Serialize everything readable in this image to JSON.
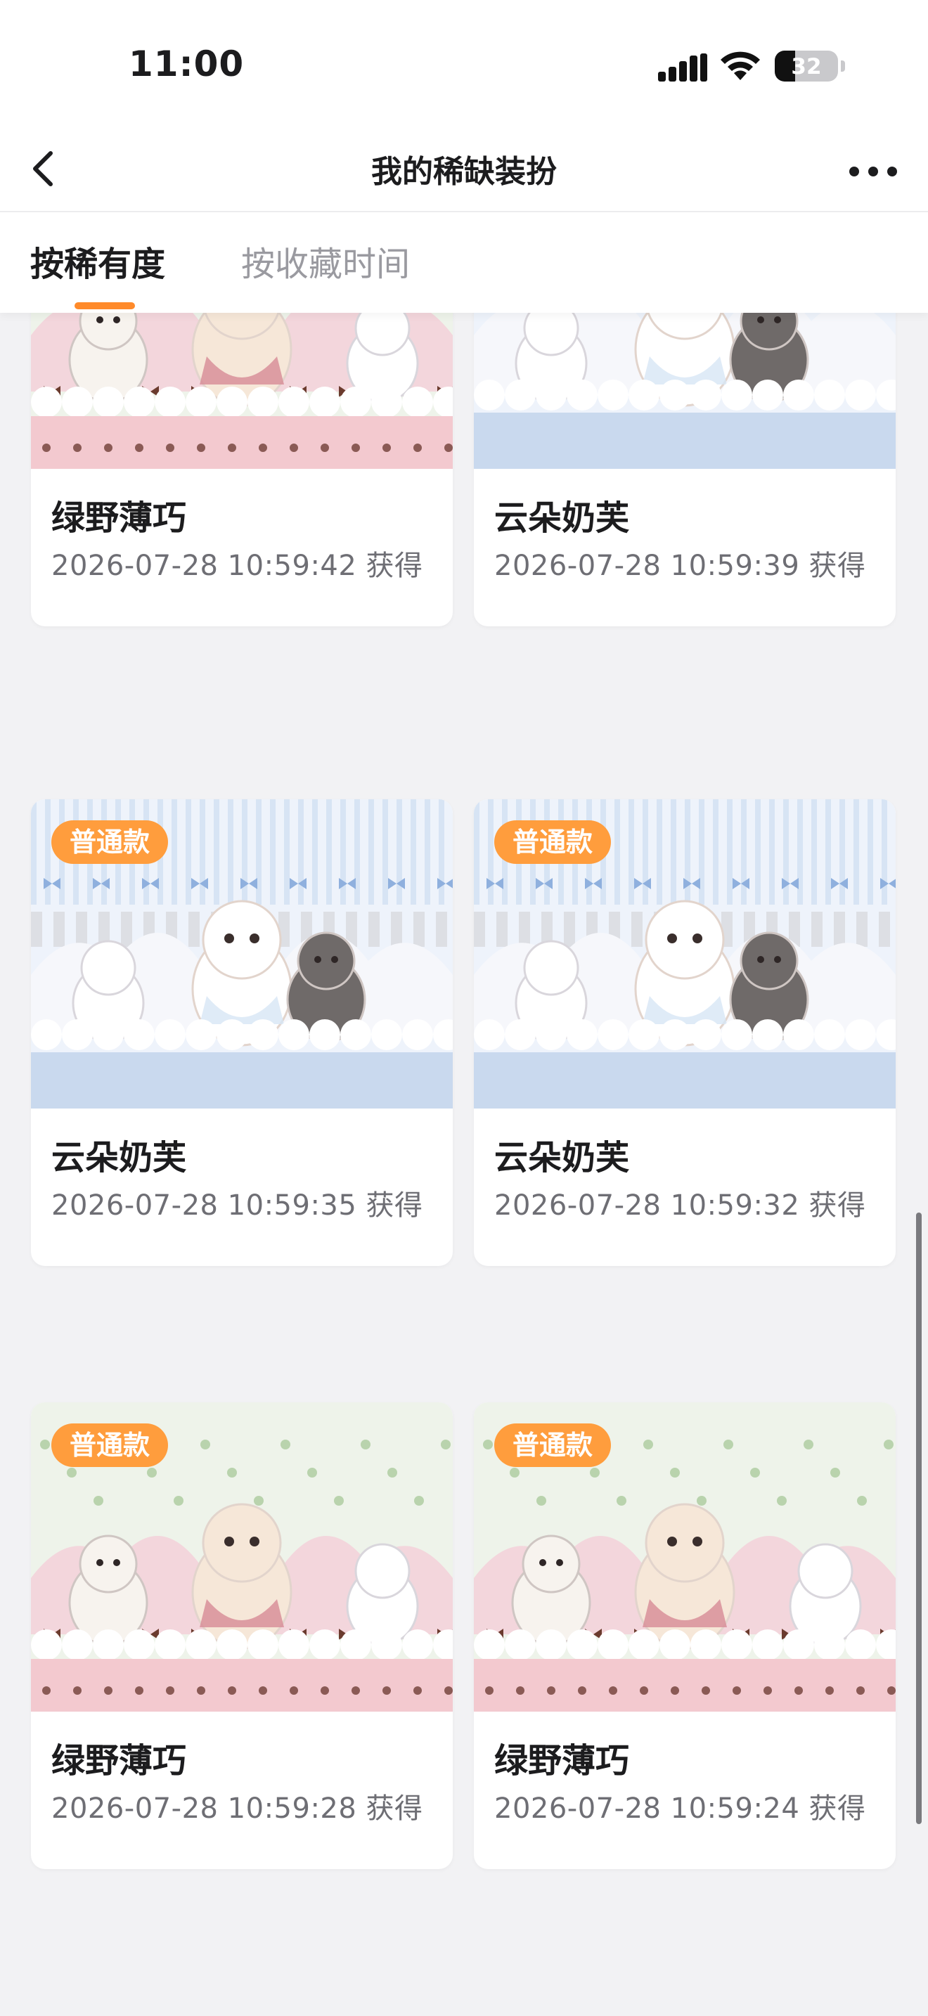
{
  "status_bar": {
    "time": "11:00",
    "battery_level": "32"
  },
  "nav": {
    "title": "我的稀缺装扮",
    "back_icon": "chevron-left-icon",
    "more_icon": "more-horizontal-icon"
  },
  "tabs": [
    {
      "label": "按稀有度",
      "active": true
    },
    {
      "label": "按收藏时间",
      "active": false
    }
  ],
  "accent_color": "#ff8a2a",
  "badge_color": "#ff9d3d",
  "cards": [
    {
      "name": "绿野薄巧",
      "date": "2026-07-28 10:59:42 获得",
      "badge": "",
      "theme": "green"
    },
    {
      "name": "云朵奶芙",
      "date": "2026-07-28 10:59:39 获得",
      "badge": "",
      "theme": "blue"
    },
    {
      "name": "云朵奶芙",
      "date": "2026-07-28 10:59:35 获得",
      "badge": "普通款",
      "theme": "blue"
    },
    {
      "name": "云朵奶芙",
      "date": "2026-07-28 10:59:32 获得",
      "badge": "普通款",
      "theme": "blue"
    },
    {
      "name": "绿野薄巧",
      "date": "2026-07-28 10:59:28 获得",
      "badge": "普通款",
      "theme": "green"
    },
    {
      "name": "绿野薄巧",
      "date": "2026-07-28 10:59:24 获得",
      "badge": "普通款",
      "theme": "green"
    }
  ]
}
